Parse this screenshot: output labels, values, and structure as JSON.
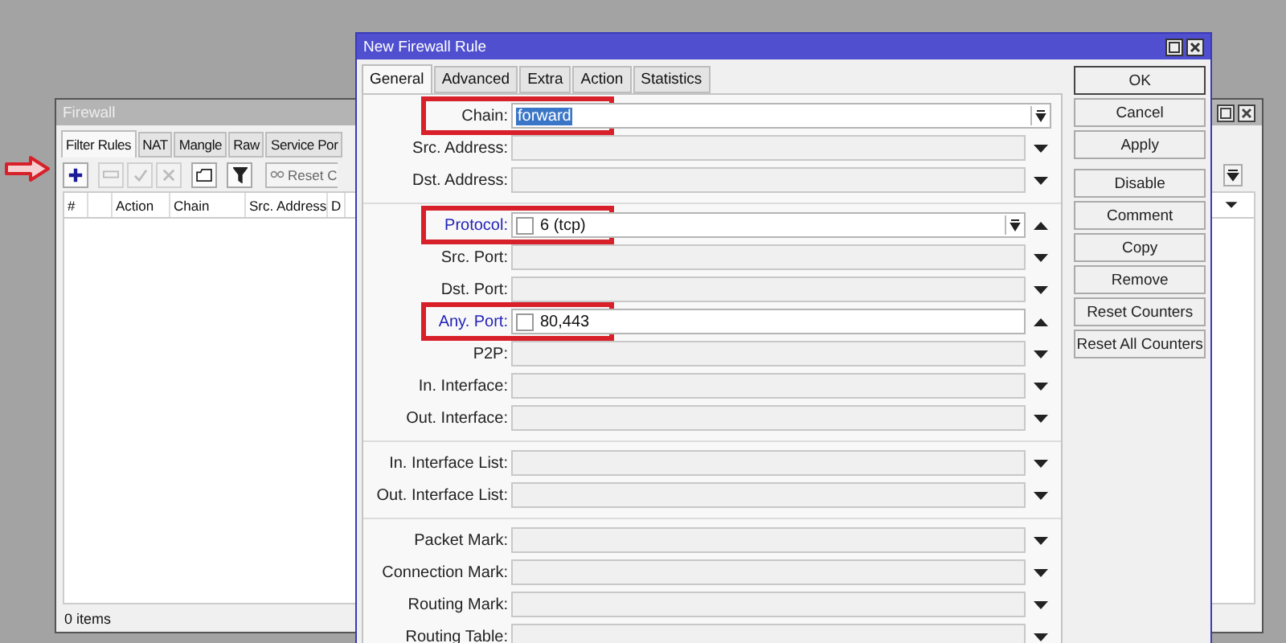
{
  "firewall_window": {
    "title": "Firewall",
    "tabs": [
      {
        "label": "Filter Rules",
        "selected": true
      },
      {
        "label": "NAT",
        "selected": false
      },
      {
        "label": "Mangle",
        "selected": false
      },
      {
        "label": "Raw",
        "selected": false
      },
      {
        "label": "Service Por",
        "selected": false
      }
    ],
    "toolbar": [
      {
        "kind": "add",
        "disabled": false
      },
      {
        "kind": "remove",
        "disabled": true
      },
      {
        "kind": "enable",
        "disabled": true
      },
      {
        "kind": "disable",
        "disabled": true
      },
      {
        "kind": "comment",
        "disabled": false
      },
      {
        "kind": "filter",
        "disabled": false
      },
      {
        "kind": "reset",
        "label": "Reset C",
        "disabled": false
      }
    ],
    "columns": [
      {
        "kind": "text",
        "label": "#"
      },
      {
        "kind": "marker"
      },
      {
        "kind": "text",
        "label": "Action"
      },
      {
        "kind": "text",
        "label": "Chain"
      },
      {
        "kind": "text",
        "label": "Src. Address"
      },
      {
        "kind": "text",
        "label": "D"
      }
    ],
    "status_bar": "0 items"
  },
  "pointer_arrow": {
    "shown": true
  },
  "dialog": {
    "title": "New Firewall Rule",
    "tabs": [
      {
        "label": "General",
        "selected": true
      },
      {
        "label": "Advanced",
        "selected": false
      },
      {
        "label": "Extra",
        "selected": false
      },
      {
        "label": "Action",
        "selected": false
      },
      {
        "label": "Statistics",
        "selected": false
      }
    ],
    "groups": [
      [
        {
          "label": "Chain:",
          "kind": "combo",
          "enabled": true,
          "value": "forward",
          "value_selected": true,
          "annotated": true,
          "active": false
        },
        {
          "label": "Src. Address:",
          "kind": "text",
          "enabled": false,
          "expanded": false,
          "annotated": false,
          "active": false
        },
        {
          "label": "Dst. Address:",
          "kind": "text",
          "enabled": false,
          "expanded": false,
          "annotated": false,
          "active": false
        }
      ],
      [
        {
          "label": "Protocol:",
          "kind": "combo",
          "enabled": true,
          "negated": false,
          "value": "6 (tcp)",
          "value_selected": false,
          "expanded": true,
          "annotated": true,
          "active": true
        },
        {
          "label": "Src. Port:",
          "kind": "text",
          "enabled": false,
          "expanded": false,
          "annotated": false,
          "active": false
        },
        {
          "label": "Dst. Port:",
          "kind": "text",
          "enabled": false,
          "expanded": false,
          "annotated": false,
          "active": false
        },
        {
          "label": "Any. Port:",
          "kind": "text",
          "enabled": true,
          "negated": false,
          "value": "80,443",
          "value_selected": false,
          "expanded": true,
          "annotated": true,
          "active": true
        },
        {
          "label": "P2P:",
          "kind": "text",
          "enabled": false,
          "expanded": false,
          "annotated": false,
          "active": false
        },
        {
          "label": "In. Interface:",
          "kind": "text",
          "enabled": false,
          "expanded": false,
          "annotated": false,
          "active": false
        },
        {
          "label": "Out. Interface:",
          "kind": "text",
          "enabled": false,
          "expanded": false,
          "annotated": false,
          "active": false
        }
      ],
      [
        {
          "label": "In. Interface List:",
          "kind": "text",
          "enabled": false,
          "expanded": false,
          "annotated": false,
          "active": false
        },
        {
          "label": "Out. Interface List:",
          "kind": "text",
          "enabled": false,
          "expanded": false,
          "annotated": false,
          "active": false
        }
      ],
      [
        {
          "label": "Packet Mark:",
          "kind": "text",
          "enabled": false,
          "expanded": false,
          "annotated": false,
          "active": false
        },
        {
          "label": "Connection Mark:",
          "kind": "text",
          "enabled": false,
          "expanded": false,
          "annotated": false,
          "active": false
        },
        {
          "label": "Routing Mark:",
          "kind": "text",
          "enabled": false,
          "expanded": false,
          "annotated": false,
          "active": false
        },
        {
          "label": "Routing Table:",
          "kind": "text",
          "enabled": false,
          "expanded": false,
          "annotated": false,
          "active": false
        }
      ]
    ],
    "button_groups": [
      [
        {
          "label": "OK",
          "default": true
        },
        {
          "label": "Cancel",
          "default": false
        },
        {
          "label": "Apply",
          "default": false
        }
      ],
      [
        {
          "label": "Disable",
          "default": false
        },
        {
          "label": "Comment",
          "default": false
        },
        {
          "label": "Copy",
          "default": false
        },
        {
          "label": "Remove",
          "default": false
        },
        {
          "label": "Reset Counters",
          "default": false
        },
        {
          "label": "Reset All Counters",
          "default": false
        }
      ]
    ]
  }
}
